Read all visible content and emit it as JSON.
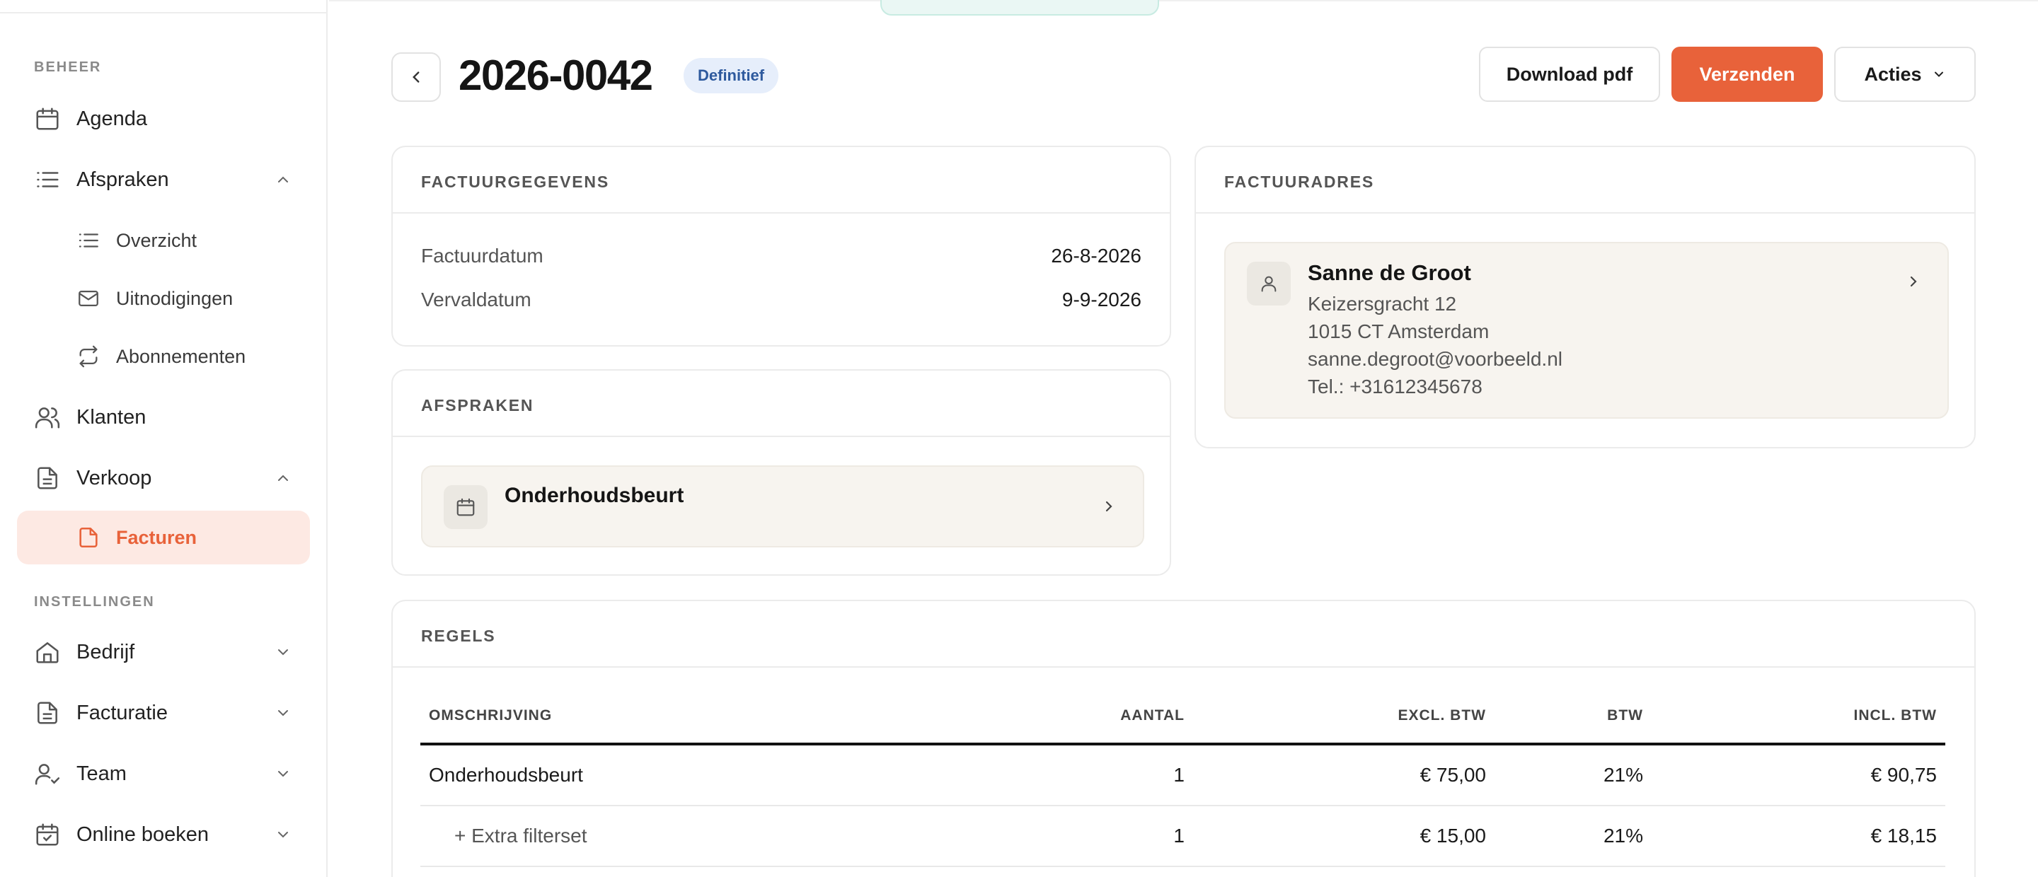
{
  "sidebar": {
    "section_beheer": "BEHEER",
    "section_instellingen": "INSTELLINGEN",
    "items": {
      "agenda": "Agenda",
      "afspraken": "Afspraken",
      "overzicht": "Overzicht",
      "uitnodigingen": "Uitnodigingen",
      "abonnementen": "Abonnementen",
      "klanten": "Klanten",
      "verkoop": "Verkoop",
      "facturen": "Facturen",
      "bedrijf": "Bedrijf",
      "facturatie": "Facturatie",
      "team": "Team",
      "online_boeken": "Online boeken"
    },
    "active_item": "Facturen",
    "accent": "#e8623a"
  },
  "header": {
    "title": "2026-0042",
    "status_badge": "Definitief",
    "download_label": "Download pdf",
    "send_label": "Verzenden",
    "actions_label": "Acties"
  },
  "invoice_details": {
    "heading": "FACTUURGEGEVENS",
    "invoice_date_label": "Factuurdatum",
    "invoice_date": "26-8-2026",
    "due_date_label": "Vervaldatum",
    "due_date": "9-9-2026"
  },
  "appointments": {
    "heading": "AFSPRAKEN",
    "items": [
      "Onderhoudsbeurt"
    ]
  },
  "billing_address": {
    "heading": "FACTUURADRES",
    "name": "Sanne de Groot",
    "street": "Keizersgracht 12",
    "city": "1015 CT Amsterdam",
    "email": "sanne.degroot@voorbeeld.nl",
    "phone": "Tel.: +31612345678"
  },
  "lines": {
    "heading": "REGELS",
    "columns": {
      "description": "OMSCHRIJVING",
      "quantity": "AANTAL",
      "excl": "EXCL. BTW",
      "vat": "BTW",
      "incl": "INCL. BTW"
    },
    "rows": [
      {
        "description": "Onderhoudsbeurt",
        "quantity": "1",
        "excl": "€ 75,00",
        "vat": "21%",
        "incl": "€ 90,75"
      },
      {
        "description": "+ Extra filterset",
        "quantity": "1",
        "excl": "€ 15,00",
        "vat": "21%",
        "incl": "€ 18,15"
      }
    ]
  }
}
